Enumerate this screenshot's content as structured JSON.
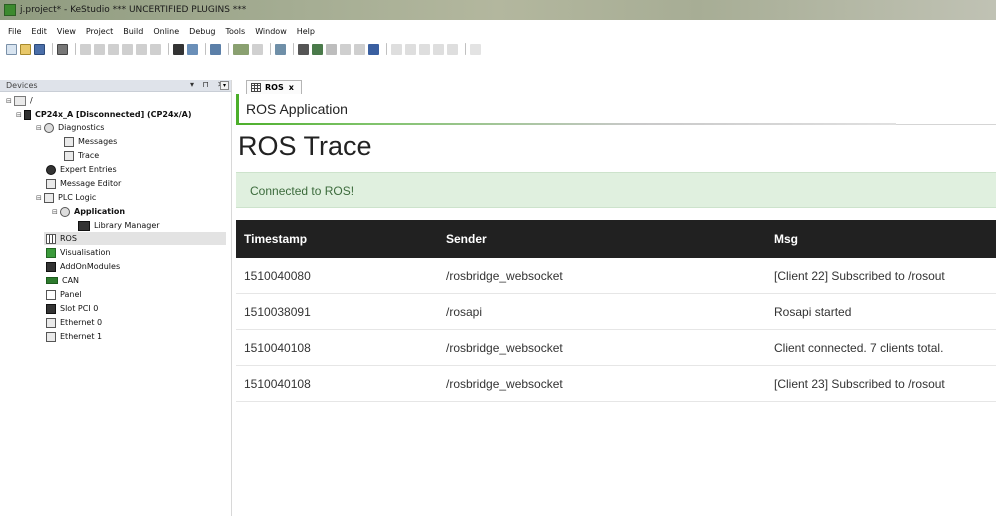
{
  "window": {
    "title": "j.project* - KeStudio  *** UNCERTIFIED PLUGINS ***"
  },
  "menu": [
    "File",
    "Edit",
    "View",
    "Project",
    "Build",
    "Online",
    "Debug",
    "Tools",
    "Window",
    "Help"
  ],
  "devices_panel": {
    "title": "Devices",
    "controls": "▾ ⊓ ✕",
    "root": "/",
    "items": [
      {
        "label": "CP24x_A [Disconnected] (CP24x/A)",
        "bold": true
      },
      {
        "label": "Diagnostics"
      },
      {
        "label": "Messages"
      },
      {
        "label": "Trace"
      },
      {
        "label": "Expert Entries"
      },
      {
        "label": "Message Editor"
      },
      {
        "label": "PLC Logic"
      },
      {
        "label": "Application",
        "bold": true
      },
      {
        "label": "Library Manager"
      },
      {
        "label": "ROS",
        "selected": true
      },
      {
        "label": "Visualisation"
      },
      {
        "label": "AddOnModules"
      },
      {
        "label": "CAN"
      },
      {
        "label": "Panel"
      },
      {
        "label": "Slot PCI 0"
      },
      {
        "label": "Ethernet 0"
      },
      {
        "label": "Ethernet 1"
      }
    ]
  },
  "editor": {
    "tab_label": "ROS",
    "tab_close": "x",
    "app_name": "ROS Application",
    "page_title": "ROS Trace",
    "status_message": "Connected to ROS!",
    "table": {
      "headers": [
        "Timestamp",
        "Sender",
        "Msg"
      ],
      "rows": [
        [
          "1510040080",
          "/rosbridge_websocket",
          "[Client 22] Subscribed to /rosout"
        ],
        [
          "1510038091",
          "/rosapi",
          "Rosapi started"
        ],
        [
          "1510040108",
          "/rosbridge_websocket",
          "Client connected. 7 clients total."
        ],
        [
          "1510040108",
          "/rosbridge_websocket",
          "[Client 23] Subscribed to /rosout"
        ]
      ]
    }
  },
  "colors": {
    "accent_green": "#4caf2a",
    "table_header": "#212121",
    "alert_bg": "#e0f0df"
  }
}
